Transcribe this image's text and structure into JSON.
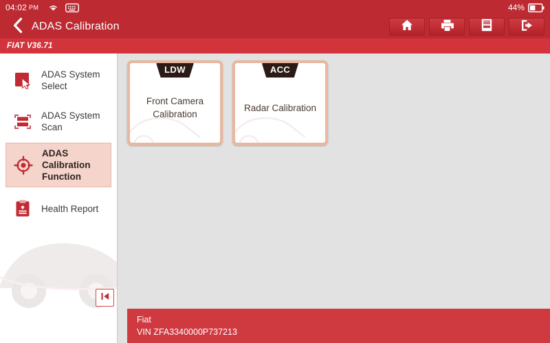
{
  "statusbar": {
    "time": "04:02",
    "ampm": "PM",
    "wifi_icon": "wifi-icon",
    "keyboard_icon": "keyboard-icon",
    "battery_percent": "44%",
    "battery_icon": "battery-icon"
  },
  "header": {
    "back_icon": "back-chevron-icon",
    "title": "ADAS Calibration",
    "toolbar": [
      {
        "name": "home-button",
        "icon": "home-icon"
      },
      {
        "name": "print-button",
        "icon": "printer-icon"
      },
      {
        "name": "report-button",
        "icon": "report-document-icon"
      },
      {
        "name": "exit-button",
        "icon": "exit-icon"
      }
    ]
  },
  "version": {
    "text": "FIAT V36.71"
  },
  "sidebar": {
    "items": [
      {
        "label": "ADAS System Select",
        "icon": "cursor-select-icon",
        "selected": false
      },
      {
        "label": "ADAS System Scan",
        "icon": "scan-icon",
        "selected": false
      },
      {
        "label": "ADAS Calibration Function",
        "icon": "crosshair-target-icon",
        "selected": true
      },
      {
        "label": "Health Report",
        "icon": "clipboard-report-icon",
        "selected": false
      }
    ],
    "collapse_icon": "collapse-panel-icon"
  },
  "main": {
    "cards": [
      {
        "badge": "LDW",
        "title": "Front Camera Calibration"
      },
      {
        "badge": "ACC",
        "title": "Radar Calibration"
      }
    ]
  },
  "vehicle": {
    "make": "Fiat",
    "vin": "VIN ZFA3340000P737213"
  },
  "colors": {
    "header_red": "#bd2a32",
    "version_red": "#d3343c",
    "vehicle_bar_red": "#cf3a41",
    "selected_bg": "#f4d4cb",
    "card_border": "#e8b89e",
    "badge_dark": "#2b1a15",
    "main_bg": "#e2e2e2"
  }
}
